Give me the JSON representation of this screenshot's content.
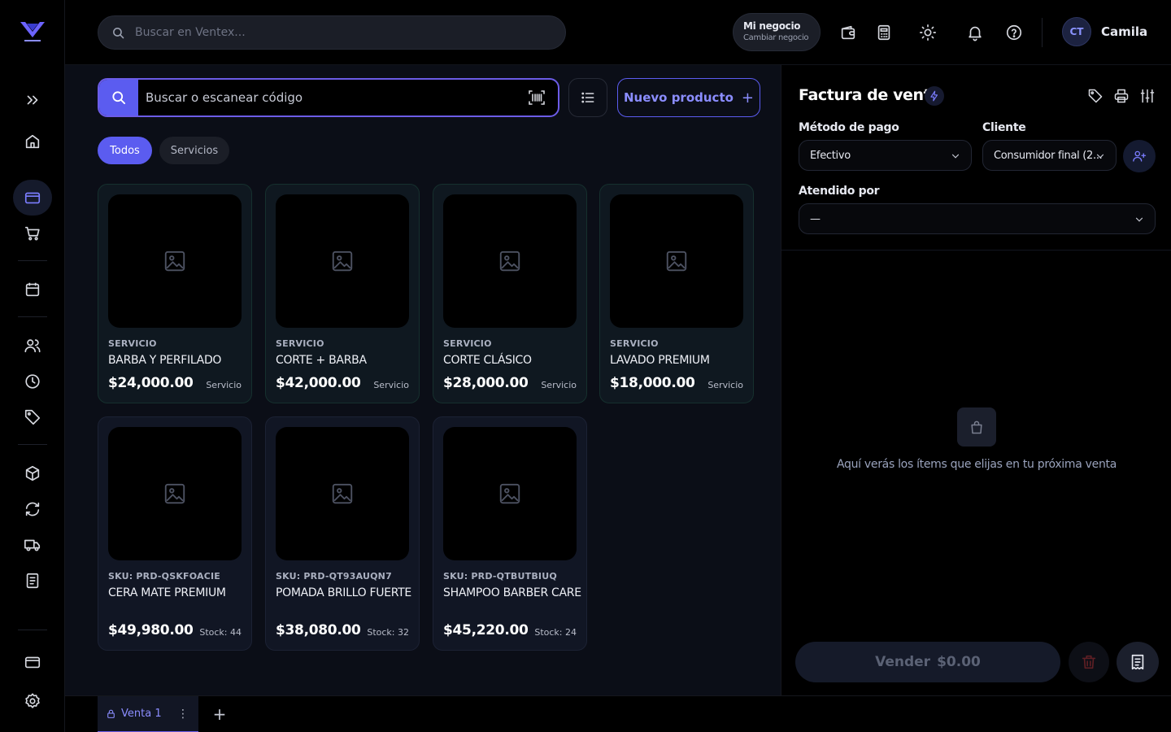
{
  "colors": {
    "accent": "#5b5cf0",
    "background": "#000000",
    "main_bg": "#0b0e17",
    "card_service_border": "#16302e"
  },
  "topbar": {
    "search_placeholder": "Buscar en Ventex...",
    "business": {
      "title": "Mi negocio",
      "subtitle": "Cambiar negocio"
    },
    "icons": [
      "wallet-icon",
      "calculator-icon",
      "sun-icon",
      "bell-icon",
      "help-icon"
    ],
    "user": {
      "initials": "CT",
      "name": "Camila"
    }
  },
  "sidebar": {
    "items": [
      "expand-icon",
      "home-icon",
      "card-icon",
      "cart-icon",
      "calendar-icon",
      "users-icon",
      "clock-icon",
      "tag-icon",
      "box-icon",
      "refresh-icon",
      "truck-icon",
      "document-icon",
      "billing-icon",
      "settings-icon"
    ],
    "active": "card-icon"
  },
  "pos": {
    "scan_placeholder": "Buscar o escanear código",
    "new_product_label": "Nuevo producto",
    "filters": [
      {
        "label": "Todos",
        "active": true
      },
      {
        "label": "Servicios",
        "active": false
      }
    ]
  },
  "products": [
    {
      "kind": "SERVICIO",
      "name": "BARBA Y PERFILADO",
      "price": "$24,000.00",
      "tag": "Servicio"
    },
    {
      "kind": "SERVICIO",
      "name": "CORTE + BARBA",
      "price": "$42,000.00",
      "tag": "Servicio"
    },
    {
      "kind": "SERVICIO",
      "name": "CORTE CLÁSICO",
      "price": "$28,000.00",
      "tag": "Servicio"
    },
    {
      "kind": "SERVICIO",
      "name": "LAVADO PREMIUM",
      "price": "$18,000.00",
      "tag": "Servicio"
    },
    {
      "kind": "SKU: PRD-QSKFOACIE",
      "name": "CERA MATE PREMIUM",
      "price": "$49,980.00",
      "tag": "Stock: 44"
    },
    {
      "kind": "SKU: PRD-QT93AUQN7",
      "name": "POMADA BRILLO FUERTE",
      "price": "$38,080.00",
      "tag": "Stock: 32"
    },
    {
      "kind": "SKU: PRD-QTBUTBIUQ",
      "name": "SHAMPOO BARBER CARE",
      "price": "$45,220.00",
      "tag": "Stock: 24"
    }
  ],
  "invoice": {
    "title": "Factura de venta",
    "payment_label": "Método de pago",
    "payment_value": "Efectivo",
    "client_label": "Cliente",
    "client_value": "Consumidor final (2...",
    "attended_label": "Atendido por",
    "attended_value": "—",
    "empty_text": "Aquí verás los ítems que elijas en tu próxima venta",
    "sell_label": "Vender",
    "sell_total": "$0.00"
  },
  "tabs": {
    "sale_tab": "Venta 1",
    "more": "⋮",
    "add": "+"
  }
}
